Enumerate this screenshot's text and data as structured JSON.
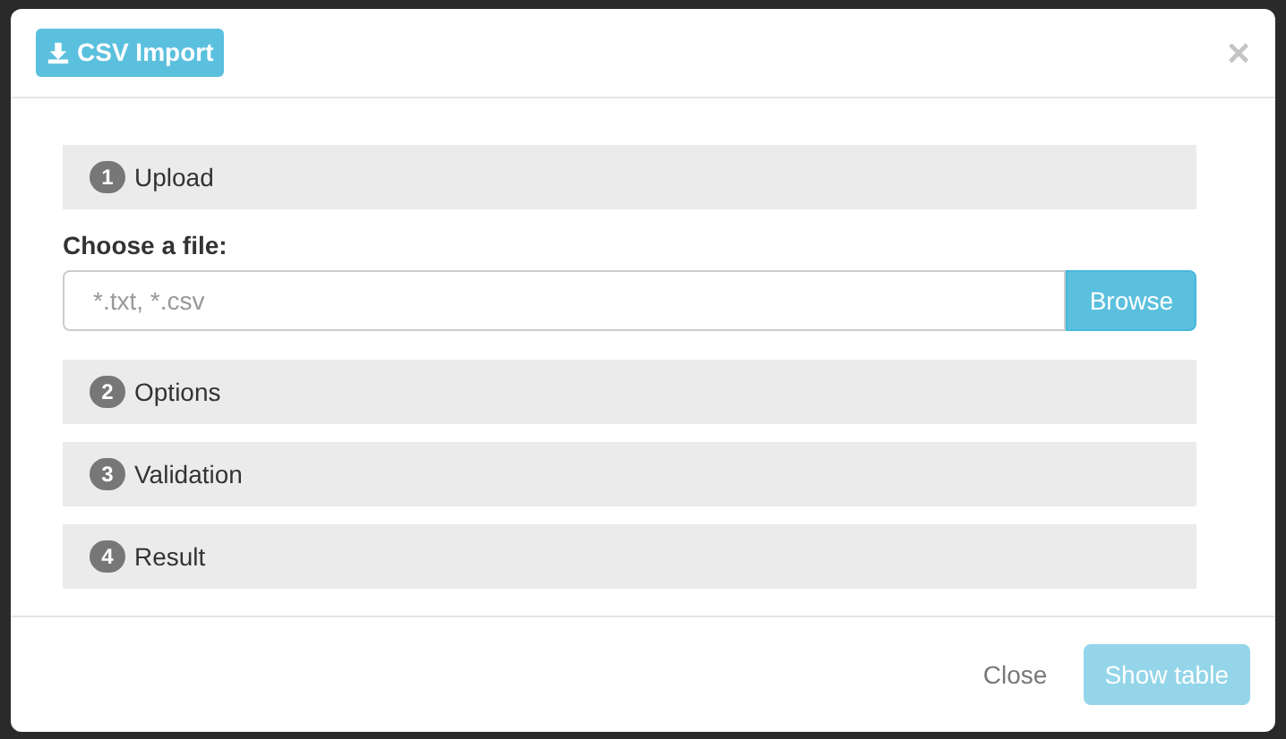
{
  "dialog": {
    "title": "CSV Import",
    "close_symbol": "×"
  },
  "steps": [
    {
      "number": "1",
      "label": "Upload",
      "file_label": "Choose a file:",
      "placeholder": "*.txt, *.csv",
      "browse": "Browse"
    },
    {
      "number": "2",
      "label": "Options"
    },
    {
      "number": "3",
      "label": "Validation"
    },
    {
      "number": "4",
      "label": "Result"
    }
  ],
  "footer": {
    "buttons": [
      {
        "label": "Close",
        "kind": "link",
        "disabled": false
      },
      {
        "label": "Show table",
        "kind": "primary",
        "disabled": true
      }
    ]
  }
}
